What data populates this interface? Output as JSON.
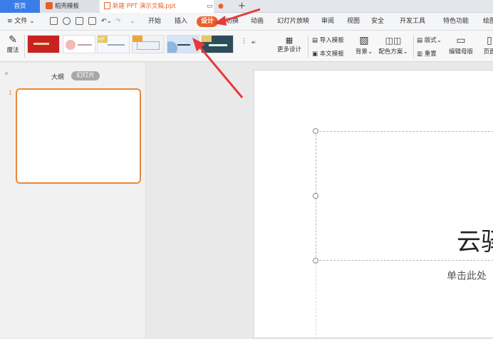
{
  "tabs": {
    "home": "首页",
    "template": "稻壳模板",
    "doc": "新建 PPT 演示文稿.ppt",
    "add": "+"
  },
  "menubar": {
    "file": "文件",
    "items": [
      "开始",
      "插入",
      "设计",
      "切换",
      "动画",
      "幻灯片放映",
      "审阅",
      "视图",
      "安全",
      "开发工具",
      "特色功能",
      "绘图"
    ]
  },
  "ribbon": {
    "magic": "魔法",
    "more_design": "更多设计",
    "import_template": "导入模板",
    "text_template": "本文模板",
    "background": "背景",
    "color_scheme": "配色方案",
    "layout": "版式",
    "reset": "重置",
    "edit_master": "编辑母版",
    "page": "页面",
    "vip": "VIP",
    "templates": [
      {
        "name": "red-template",
        "color": "#c8231f"
      },
      {
        "name": "floral-template",
        "color": "#f3d6d6"
      },
      {
        "name": "watercolor-template",
        "color": "#e7eef7"
      },
      {
        "name": "botanical-template",
        "color": "#f0e6d6"
      },
      {
        "name": "gray-frame-template",
        "color": "#e6e9ee"
      },
      {
        "name": "blue-wave-template",
        "color": "#9dc0e6"
      },
      {
        "name": "dark-forest-template",
        "color": "#2f4c5a"
      }
    ]
  },
  "leftpanel": {
    "outline": "大纲",
    "slides": "幻灯片",
    "slide_number": "1"
  },
  "slide": {
    "title": "云驿",
    "subtitle": "单击此处"
  },
  "colors": {
    "accent": "#e8612c",
    "home_tab": "#3b7de8",
    "arrow": "#e8393a"
  }
}
